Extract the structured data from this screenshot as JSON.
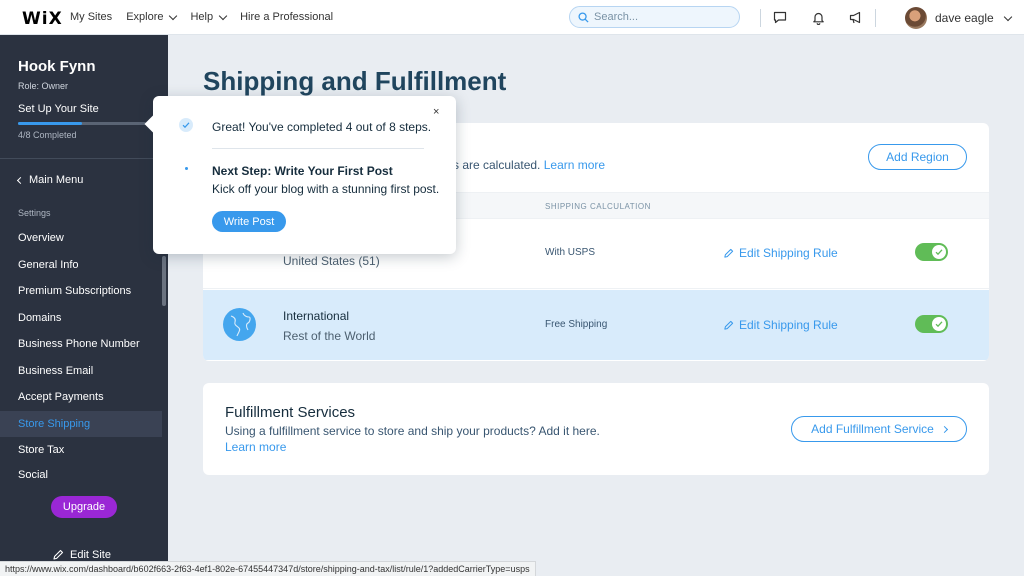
{
  "topbar": {
    "logo": "WiX",
    "nav": [
      {
        "label": "My Sites",
        "dropdown": false
      },
      {
        "label": "Explore",
        "dropdown": true
      },
      {
        "label": "Help",
        "dropdown": true
      },
      {
        "label": "Hire a Professional",
        "dropdown": false
      }
    ],
    "search_placeholder": "Search...",
    "icons": [
      "chat-icon",
      "bell-icon",
      "megaphone-icon"
    ],
    "user_name": "dave eagle"
  },
  "sidebar": {
    "site_name": "Hook Fynn",
    "role": "Role: Owner",
    "setup_label": "Set Up Your Site",
    "progress_fraction": 0.5,
    "progress_text": "4/8 Completed",
    "main_menu": "Main Menu",
    "section_label": "Settings",
    "items": [
      {
        "label": "Overview",
        "active": false
      },
      {
        "label": "General Info",
        "active": false
      },
      {
        "label": "Premium Subscriptions",
        "active": false
      },
      {
        "label": "Domains",
        "active": false
      },
      {
        "label": "Business Phone Number",
        "active": false
      },
      {
        "label": "Business Email",
        "active": false
      },
      {
        "label": "Accept Payments",
        "active": false
      },
      {
        "label": "Store Shipping",
        "active": true
      },
      {
        "label": "Store Tax",
        "active": false
      },
      {
        "label": "Social",
        "active": false
      }
    ],
    "upgrade_label": "Upgrade",
    "edit_site_label": "Edit Site"
  },
  "main": {
    "title": "Shipping and Fulfillment",
    "regions_card": {
      "description": "s are calculated.",
      "learn_more": "Learn more",
      "add_region_label": "Add Region",
      "column_calc": "SHIPPING CALCULATION",
      "rows": [
        {
          "name": "",
          "sub": "United States (51)",
          "calc": "With USPS",
          "edit_label": "Edit Shipping Rule",
          "enabled": true
        },
        {
          "name": "International",
          "sub": "Rest of the World",
          "calc": "Free Shipping",
          "edit_label": "Edit Shipping Rule",
          "enabled": true
        }
      ]
    },
    "fulfillment_card": {
      "title": "Fulfillment Services",
      "description": "Using a fulfillment service to store and ship your products? Add it here.",
      "learn_more": "Learn more",
      "add_label": "Add Fulfillment Service"
    }
  },
  "popup": {
    "close": "×",
    "message": "Great! You've completed 4 out of 8 steps.",
    "next_step": "Next Step: Write Your First Post",
    "next_desc": "Kick off your blog with a stunning first post.",
    "button_label": "Write Post"
  },
  "statusbar": {
    "url": "https://www.wix.com/dashboard/b602f663-2f63-4ef1-802e-67455447347d/store/shipping-and-tax/list/rule/1?addedCarrierType=usps"
  },
  "colors": {
    "accent": "#3899ec",
    "sidebar_bg": "#2b3240",
    "upgrade": "#9a27d5",
    "toggle_on": "#60bc57",
    "title": "#20455e"
  }
}
